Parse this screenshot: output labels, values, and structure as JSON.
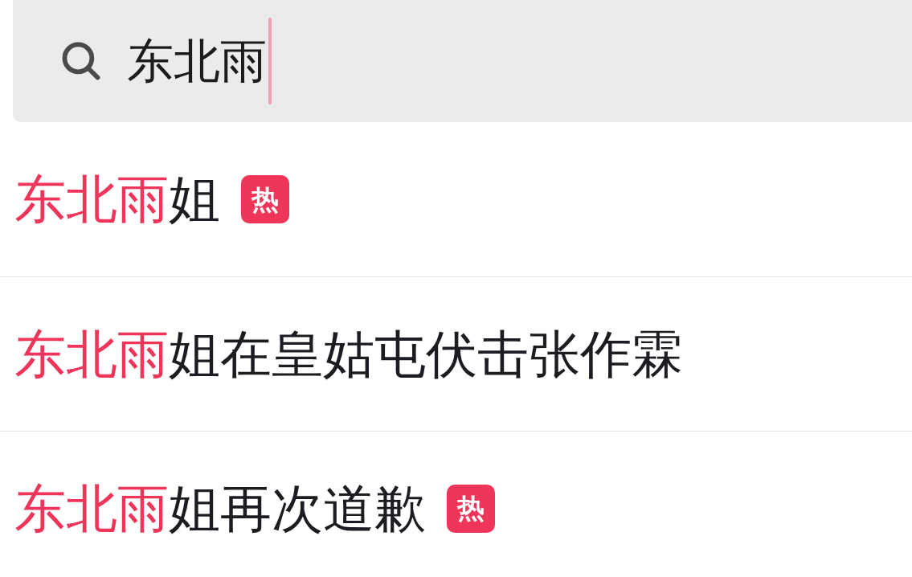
{
  "search": {
    "value": "东北雨"
  },
  "suggestions": [
    {
      "match": "东北雨",
      "rest": "姐",
      "badge": "热"
    },
    {
      "match": "东北雨",
      "rest": "姐在皇姑屯伏击张作霖"
    },
    {
      "match": "东北雨",
      "rest": "姐再次道歉",
      "badge": "热"
    }
  ]
}
